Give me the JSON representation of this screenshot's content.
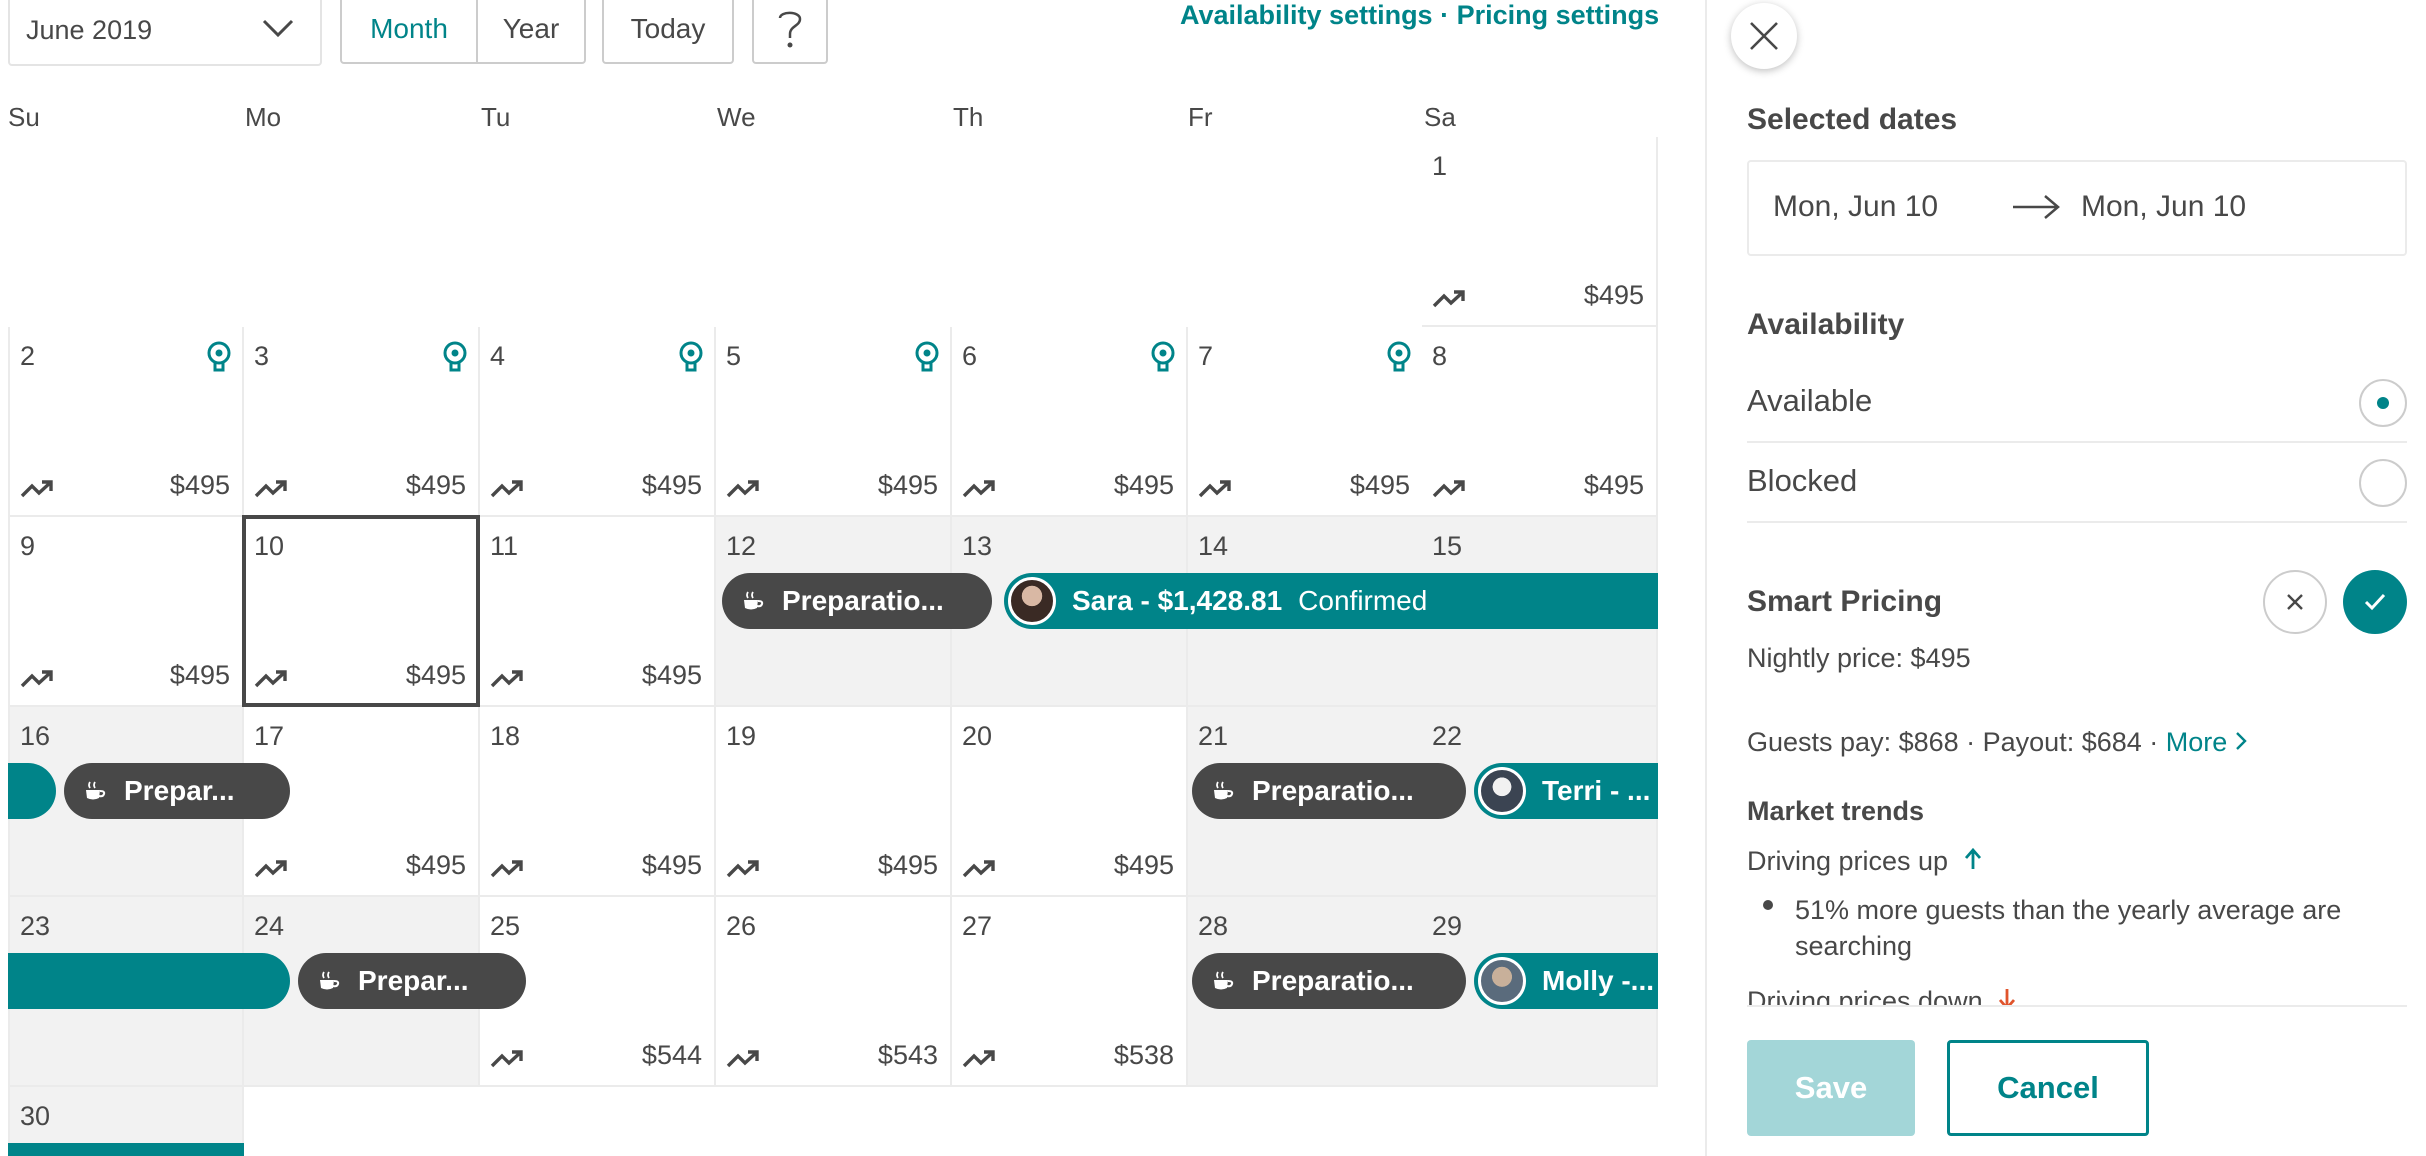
{
  "toolbar": {
    "month_select": "June 2019",
    "view_month": "Month",
    "view_year": "Year",
    "today": "Today",
    "help": "?",
    "availability_settings": "Availability settings",
    "separator": " · ",
    "pricing_settings": "Pricing settings"
  },
  "weekdays": [
    "Su",
    "Mo",
    "Tu",
    "We",
    "Th",
    "Fr",
    "Sa"
  ],
  "calendar": {
    "days": {
      "d1": {
        "num": "1",
        "price": "$495"
      },
      "d2": {
        "num": "2",
        "price": "$495"
      },
      "d3": {
        "num": "3",
        "price": "$495"
      },
      "d4": {
        "num": "4",
        "price": "$495"
      },
      "d5": {
        "num": "5",
        "price": "$495"
      },
      "d6": {
        "num": "6",
        "price": "$495"
      },
      "d7": {
        "num": "7",
        "price": "$495"
      },
      "d8": {
        "num": "8",
        "price": "$495"
      },
      "d9": {
        "num": "9",
        "price": "$495"
      },
      "d10": {
        "num": "10",
        "price": "$495"
      },
      "d11": {
        "num": "11",
        "price": "$495"
      },
      "d12": {
        "num": "12"
      },
      "d13": {
        "num": "13"
      },
      "d14": {
        "num": "14"
      },
      "d15": {
        "num": "15"
      },
      "d16": {
        "num": "16"
      },
      "d17": {
        "num": "17",
        "price": "$495"
      },
      "d18": {
        "num": "18",
        "price": "$495"
      },
      "d19": {
        "num": "19",
        "price": "$495"
      },
      "d20": {
        "num": "20",
        "price": "$495"
      },
      "d21": {
        "num": "21"
      },
      "d22": {
        "num": "22"
      },
      "d23": {
        "num": "23"
      },
      "d24": {
        "num": "24"
      },
      "d25": {
        "num": "25",
        "price": "$544"
      },
      "d26": {
        "num": "26",
        "price": "$543"
      },
      "d27": {
        "num": "27",
        "price": "$538"
      },
      "d28": {
        "num": "28"
      },
      "d29": {
        "num": "29"
      },
      "d30": {
        "num": "30"
      }
    },
    "events": {
      "prep_12": "Preparatio...",
      "sara_name": "Sara - $1,428.81",
      "sara_status": "Confirmed",
      "prep_16": "Prepar...",
      "prep_21": "Preparatio...",
      "terri": "Terri - ...",
      "prep_24": "Prepar...",
      "prep_28": "Preparatio...",
      "molly": "Molly -..."
    }
  },
  "panel": {
    "selected_dates_title": "Selected dates",
    "start_date": "Mon, Jun 10",
    "end_date": "Mon, Jun 10",
    "availability_title": "Availability",
    "available_label": "Available",
    "blocked_label": "Blocked",
    "availability_selected": "Available",
    "smart_pricing_title": "Smart Pricing",
    "nightly_price": "Nightly price: $495",
    "guests_payout": "Guests pay: $868 · Payout: $684 · ",
    "more_link": "More",
    "market_trends_title": "Market trends",
    "driving_up": "Driving prices up",
    "trend_bullet": "51% more guests than the yearly average are searching",
    "driving_down": "Driving prices down",
    "save_button": "Save",
    "cancel_button": "Cancel"
  },
  "colors": {
    "accent": "#008489",
    "text": "#484848",
    "border": "#ebebeb",
    "past_day_bg": "#f2f2f2",
    "prep_bar": "#484848",
    "save_disabled": "#a3d6d8",
    "trend_down": "#e0542c"
  },
  "icons": {
    "month_dropdown": "chevron-down-icon",
    "help": "question-mark-icon",
    "insight": "lightbulb-icon",
    "trend": "trend-up-arrow-icon",
    "preparation": "coffee-cup-icon",
    "close": "close-icon",
    "date_range": "right-arrow-icon",
    "decline": "x-icon",
    "accept": "checkmark-icon",
    "more": "chevron-right-icon",
    "driving_up": "arrow-up-icon",
    "driving_down": "arrow-down-icon"
  }
}
